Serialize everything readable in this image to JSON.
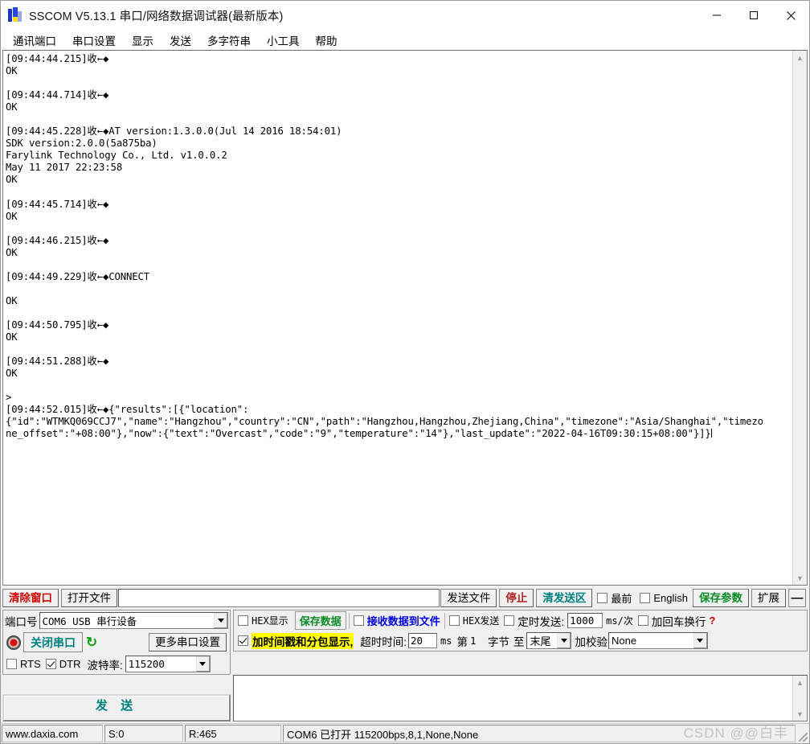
{
  "window": {
    "title": "SSCOM V5.13.1 串口/网络数据调试器(最新版本)",
    "minimize": "—",
    "maximize": "□",
    "close": "✕"
  },
  "menu": {
    "items": [
      {
        "label": "通讯端口"
      },
      {
        "label": "串口设置"
      },
      {
        "label": "显示"
      },
      {
        "label": "发送"
      },
      {
        "label": "多字符串"
      },
      {
        "label": "小工具"
      },
      {
        "label": "帮助"
      }
    ]
  },
  "terminal": {
    "lines": [
      "[09:44:44.215]收←◆",
      "OK",
      "",
      "[09:44:44.714]收←◆",
      "OK",
      "",
      "[09:44:45.228]收←◆AT version:1.3.0.0(Jul 14 2016 18:54:01)",
      "SDK version:2.0.0(5a875ba)",
      "Farylink Technology Co., Ltd. v1.0.0.2",
      "May 11 2017 22:23:58",
      "OK",
      "",
      "[09:44:45.714]收←◆",
      "OK",
      "",
      "[09:44:46.215]收←◆",
      "OK",
      "",
      "[09:44:49.229]收←◆CONNECT",
      "",
      "OK",
      "",
      "[09:44:50.795]收←◆",
      "OK",
      "",
      "[09:44:51.288]收←◆",
      "OK",
      "",
      ">",
      "[09:44:52.015]收←◆{\"results\":[{\"location\":",
      "{\"id\":\"WTMKQ069CCJ7\",\"name\":\"Hangzhou\",\"country\":\"CN\",\"path\":\"Hangzhou,Hangzhou,Zhejiang,China\",\"timezone\":\"Asia/Shanghai\",\"timezo",
      "ne_offset\":\"+08:00\"},\"now\":{\"text\":\"Overcast\",\"code\":\"9\",\"temperature\":\"14\"},\"last_update\":\"2022-04-16T09:30:15+08:00\"}]}"
    ]
  },
  "toolbar": {
    "clear_window": "清除窗口",
    "open_file": "打开文件",
    "file_path": "",
    "send_file": "发送文件",
    "stop": "停止",
    "clear_send": "清发送区",
    "topmost": "最前",
    "english": "English",
    "save_params": "保存参数",
    "extend": "扩展",
    "minus": "—"
  },
  "port_panel": {
    "port_label": "端口号",
    "port_value": "COM6 USB 串行设备",
    "close_port": "关闭串口",
    "more_settings": "更多串口设置",
    "rts": "RTS",
    "dtr": "DTR",
    "baud_label": "波特率:",
    "baud_value": "115200"
  },
  "recv_panel": {
    "hex_display": "HEX显示",
    "save_data": "保存数据",
    "recv_to_file": "接收数据到文件",
    "hex_send": "HEX发送",
    "timed_send": "定时发送:",
    "timed_value": "1000",
    "ms_per": "ms/次",
    "add_crlf": "加回车换行",
    "timestamp_pack": "加时间戳和分包显示,",
    "timeout_label": "超时时间:",
    "timeout_value": "20",
    "ms": "ms",
    "byte_from": "第",
    "byte_from_value": "1",
    "byte_label": "字节",
    "to_label": "至",
    "to_value": "末尾",
    "checksum_label": "加校验",
    "checksum_value": "None",
    "help_mark": "?"
  },
  "send_panel": {
    "send_button": "发  送",
    "send_text": ""
  },
  "statusbar": {
    "site": "www.daxia.com",
    "sent": "S:0",
    "received": "R:465",
    "conn": "COM6 已打开  115200bps,8,1,None,None",
    "watermark": "CSDN @@白丰"
  },
  "colors": {
    "red": "#d00000",
    "green": "#0a8a26",
    "teal": "#008080",
    "blue": "#0000dd",
    "highlight": "#ffff00"
  }
}
